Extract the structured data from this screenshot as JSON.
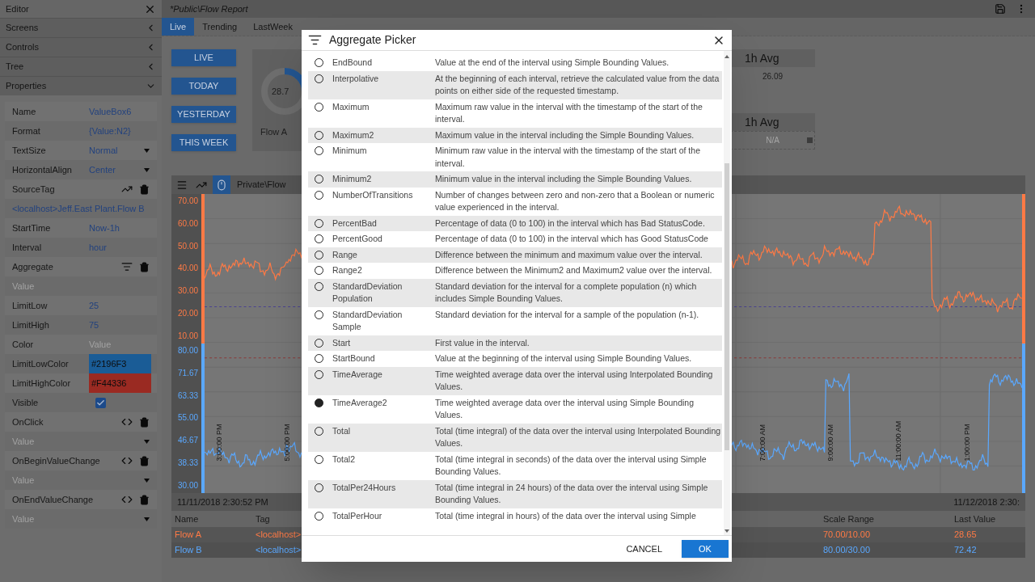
{
  "sidebar": {
    "title": "Editor",
    "sections": [
      {
        "label": "Screens",
        "expanded": false
      },
      {
        "label": "Controls",
        "expanded": false
      },
      {
        "label": "Tree",
        "expanded": false
      },
      {
        "label": "Properties",
        "expanded": true
      }
    ],
    "properties": [
      {
        "kind": "text",
        "label": "Name",
        "value": "ValueBox6"
      },
      {
        "kind": "text",
        "label": "Format",
        "value": "{Value:N2}"
      },
      {
        "kind": "select",
        "label": "TextSize",
        "value": "Normal"
      },
      {
        "kind": "select",
        "label": "HorizontalAlign",
        "value": "Center"
      },
      {
        "kind": "trend_action",
        "label": "SourceTag"
      },
      {
        "kind": "wide_value",
        "value": "<localhost>Jeff.East Plant.Flow B"
      },
      {
        "kind": "text",
        "label": "StartTime",
        "value": "Now-1h"
      },
      {
        "kind": "text",
        "label": "Interval",
        "value": "hour"
      },
      {
        "kind": "filter_action",
        "label": "Aggregate"
      },
      {
        "kind": "wide_placeholder",
        "placeholder": "Value"
      },
      {
        "kind": "text",
        "label": "LimitLow",
        "value": "25"
      },
      {
        "kind": "text",
        "label": "LimitHigh",
        "value": "75"
      },
      {
        "kind": "placeholder",
        "label": "Color",
        "placeholder": "Value"
      },
      {
        "kind": "color",
        "label": "LimitLowColor",
        "value": "#2196F3",
        "color": "#1a5c96"
      },
      {
        "kind": "color",
        "label": "LimitHighColor",
        "value": "#F44336",
        "color": "#9a2a22"
      },
      {
        "kind": "checkbox",
        "label": "Visible",
        "checked": true
      },
      {
        "kind": "script_action",
        "label": "OnClick"
      },
      {
        "kind": "wide_dropdown",
        "placeholder": "Value"
      },
      {
        "kind": "script_action",
        "label": "OnBeginValueChange"
      },
      {
        "kind": "wide_dropdown",
        "placeholder": "Value"
      },
      {
        "kind": "script_action",
        "label": "OnEndValueChange"
      },
      {
        "kind": "wide_dropdown",
        "placeholder": "Value"
      }
    ]
  },
  "screen": {
    "title": "*Public\\Flow Report",
    "tabs": [
      {
        "label": "Live",
        "selected": true
      },
      {
        "label": "Trending",
        "selected": false
      },
      {
        "label": "LastWeek",
        "selected": false
      }
    ],
    "buttons": [
      "LIVE",
      "TODAY",
      "YESTERDAY",
      "THIS WEEK"
    ],
    "gauge": {
      "value": "28.7",
      "label": "Flow A"
    },
    "value_boxes": [
      {
        "title": "1h Avg",
        "value": "26.09",
        "dimmed": false
      },
      {
        "title": "1h Avg",
        "value": "N/A",
        "dimmed": true
      }
    ],
    "trend": {
      "title": "Private\\Flow",
      "axes": [
        {
          "color": "#ff7a45",
          "labels": [
            "70.00",
            "60.00",
            "50.00",
            "40.00",
            "30.00",
            "20.00",
            "10.00"
          ]
        },
        {
          "color": "#5aa8ff",
          "labels": [
            "80.00",
            "71.67",
            "63.33",
            "55.00",
            "46.67",
            "38.33",
            "30.00"
          ]
        }
      ],
      "time_labels": [
        "3:00:00 PM",
        "5:00:00 PM",
        "7:00:00 AM",
        "9:00:00 AM",
        "11:00:00 AM",
        "1:00:00 PM"
      ],
      "start": "11/11/2018 2:30:52 PM",
      "end": "11/12/2018 2:30:",
      "columns": [
        "Name",
        "Tag",
        "Scale Range",
        "Last Value"
      ],
      "rows": [
        {
          "name": "Flow A",
          "tag": "<localhost>",
          "scale": "70.00/10.00",
          "last": "28.65",
          "color": "#ff7a45"
        },
        {
          "name": "Flow B",
          "tag": "<localhost>",
          "scale": "80.00/30.00",
          "last": "72.42",
          "color": "#5aa8ff"
        }
      ]
    }
  },
  "dialog": {
    "title": "Aggregate Picker",
    "options": [
      {
        "name": "EndBound",
        "description": "Value at the end of the interval using Simple Bounding Values.",
        "selected": false
      },
      {
        "name": "Interpolative",
        "description": "At the beginning of each interval, retrieve the calculated value from the data points on either side of the requested timestamp.",
        "selected": false
      },
      {
        "name": "Maximum",
        "description": "Maximum raw value in the interval with the timestamp of the start of the interval.",
        "selected": false
      },
      {
        "name": "Maximum2",
        "description": "Maximum value in the interval including the Simple Bounding Values.",
        "selected": false
      },
      {
        "name": "Minimum",
        "description": "Minimum raw value in the interval with the timestamp of the start of the interval.",
        "selected": false
      },
      {
        "name": "Minimum2",
        "description": "Minimum value in the interval including the Simple Bounding Values.",
        "selected": false
      },
      {
        "name": "NumberOfTransitions",
        "description": "Number of changes between zero and non-zero that a Boolean or numeric value experienced in the interval.",
        "selected": false
      },
      {
        "name": "PercentBad",
        "description": "Percentage of data (0 to 100) in the interval which has Bad StatusCode.",
        "selected": false
      },
      {
        "name": "PercentGood",
        "description": "Percentage of data (0 to 100) in the interval which has Good StatusCode",
        "selected": false
      },
      {
        "name": "Range",
        "description": "Difference between the minimum and maximum value over the interval.",
        "selected": false
      },
      {
        "name": "Range2",
        "description": "Difference between the Minimum2 and Maximum2 value over the interval.",
        "selected": false
      },
      {
        "name": "StandardDeviation Population",
        "description": "Standard deviation for the interval for a complete population (n) which includes Simple Bounding Values.",
        "selected": false
      },
      {
        "name": "StandardDeviation Sample",
        "description": "Standard deviation for the interval for a sample of the population (n-1).",
        "selected": false
      },
      {
        "name": "Start",
        "description": "First value in the interval.",
        "selected": false
      },
      {
        "name": "StartBound",
        "description": "Value at the beginning of the interval using Simple Bounding Values.",
        "selected": false
      },
      {
        "name": "TimeAverage",
        "description": "Time weighted average data over the interval using Interpolated Bounding Values.",
        "selected": false
      },
      {
        "name": "TimeAverage2",
        "description": "Time weighted average data over the interval using Simple Bounding Values.",
        "selected": true
      },
      {
        "name": "Total",
        "description": "Total (time integral) of the data over the interval using Interpolated Bounding Values.",
        "selected": false
      },
      {
        "name": "Total2",
        "description": "Total (time integral in seconds) of the data over the interval using Simple Bounding Values.",
        "selected": false
      },
      {
        "name": "TotalPer24Hours",
        "description": "Total (time integral in 24 hours) of the data over the interval using Simple Bounding Values.",
        "selected": false
      },
      {
        "name": "TotalPerHour",
        "description": "Total (time integral in hours) of the data over the interval using Simple",
        "selected": false
      }
    ],
    "cancel": "CANCEL",
    "ok": "OK"
  }
}
